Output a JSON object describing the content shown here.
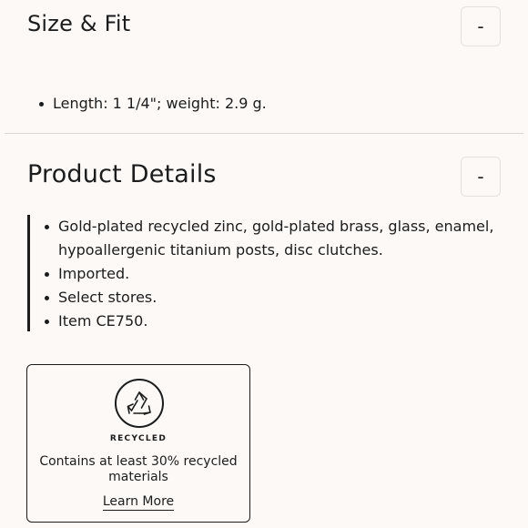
{
  "size_fit": {
    "title": "Size & Fit",
    "toggle_label": "-",
    "items": [
      "Length: 1 1/4\"; weight: 2.9 g."
    ]
  },
  "product_details": {
    "title": "Product Details",
    "toggle_label": "-",
    "items": [
      "Gold-plated recycled zinc, gold-plated brass, glass, enamel, hypoallergenic titanium posts, disc clutches.",
      "Imported.",
      "Select stores.",
      "Item CE750."
    ]
  },
  "recycled_card": {
    "icon": "recycle-icon",
    "badge": "RECYCLED",
    "text": "Contains at least 30% recycled materials",
    "link": "Learn More"
  }
}
